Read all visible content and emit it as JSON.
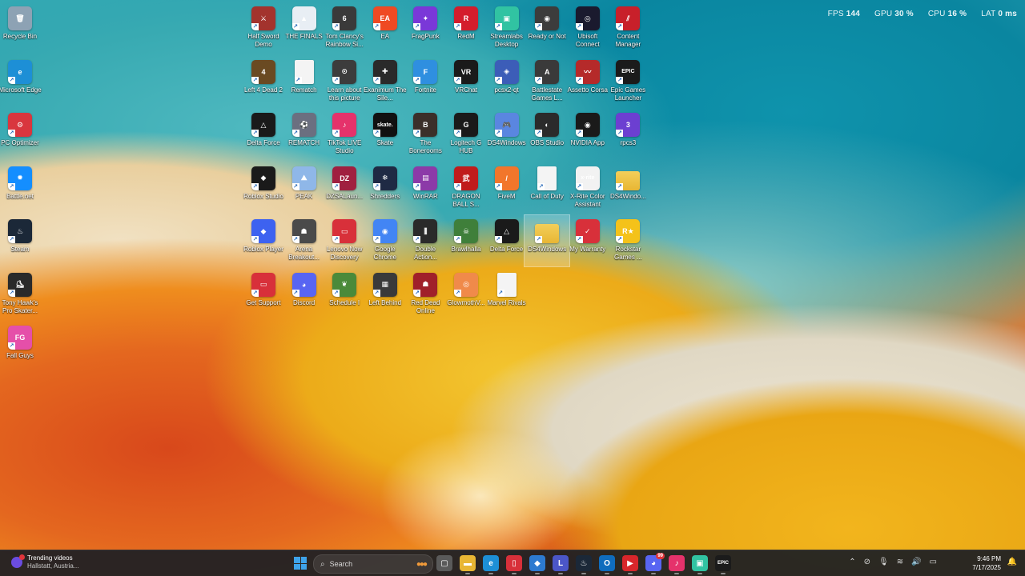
{
  "overlay": {
    "fps_label": "FPS",
    "fps_value": "144",
    "gpu_label": "GPU",
    "gpu_value": "30 %",
    "cpu_label": "CPU",
    "cpu_value": "16 %",
    "lat_label": "LAT",
    "lat_value": "0 ms"
  },
  "desktop": {
    "icons": [
      {
        "label": "Recycle Bin",
        "icon": "recycle-bin-icon",
        "color": "#8da2b4",
        "glyph": "🗑"
      },
      {
        "label": "Microsoft Edge",
        "icon": "edge-icon",
        "color": "#1d8fd6",
        "glyph": "e"
      },
      {
        "label": "PC Optimizer",
        "icon": "pc-optimizer-icon",
        "color": "#d9363e",
        "glyph": "⚙"
      },
      {
        "label": "Battle.net",
        "icon": "battlenet-icon",
        "color": "#148eff",
        "glyph": "✹"
      },
      {
        "label": "Steam",
        "icon": "steam-icon",
        "color": "#1b2838",
        "glyph": "♨"
      },
      {
        "label": "Tony Hawk's Pro Skater...",
        "icon": "tony-hawk-icon",
        "color": "#2a2a2a",
        "glyph": "⛸"
      },
      {
        "label": "Fall Guys",
        "icon": "fall-guys-icon",
        "color": "#e54fa9",
        "glyph": "FG"
      },
      {
        "label": "Half Sword Demo",
        "icon": "half-sword-icon",
        "color": "#a3332d",
        "glyph": "⚔"
      },
      {
        "label": "THE FINALS",
        "icon": "the-finals-icon",
        "color": "#e8eef4",
        "glyph": "▲"
      },
      {
        "label": "Tom Clancy's Rainbow Si...",
        "icon": "rainbow-six-icon",
        "color": "#3a3a3a",
        "glyph": "6"
      },
      {
        "label": "EA",
        "icon": "ea-icon",
        "color": "#ef4a23",
        "glyph": "EA"
      },
      {
        "label": "FragPunk",
        "icon": "fragpunk-icon",
        "color": "#7a38d8",
        "glyph": "✦"
      },
      {
        "label": "RedM",
        "icon": "redm-icon",
        "color": "#d41d2c",
        "glyph": "R"
      },
      {
        "label": "Streamlabs Desktop",
        "icon": "streamlabs-icon",
        "color": "#31c3a2",
        "glyph": "▣"
      },
      {
        "label": "Ready or Not",
        "icon": "ready-or-not-icon",
        "color": "#3c3c3c",
        "glyph": "◉"
      },
      {
        "label": "Ubisoft Connect",
        "icon": "ubisoft-icon",
        "color": "#1a1a2e",
        "glyph": "◎"
      },
      {
        "label": "Content Manager",
        "icon": "content-manager-icon",
        "color": "#c8202a",
        "glyph": "⫽"
      },
      {
        "label": "Left 4 Dead 2",
        "icon": "left4dead-icon",
        "color": "#6a4a22",
        "glyph": "4"
      },
      {
        "label": "Rematch",
        "icon": "rematch-file-icon",
        "color": "#f4f4f4",
        "glyph": "",
        "type": "doc"
      },
      {
        "label": "Learn about this picture",
        "icon": "spotlight-icon",
        "color": "#3c3c3c",
        "glyph": "⊙"
      },
      {
        "label": "Exanimum The Sile...",
        "icon": "exanimum-icon",
        "color": "#2a2a2a",
        "glyph": "✚"
      },
      {
        "label": "Fortnite",
        "icon": "fortnite-icon",
        "color": "#2f8fe0",
        "glyph": "F"
      },
      {
        "label": "VRChat",
        "icon": "vrchat-icon",
        "color": "#1a1a1a",
        "glyph": "VR"
      },
      {
        "label": "pcsx2-qt",
        "icon": "pcsx2-icon",
        "color": "#3c5db8",
        "glyph": "◈"
      },
      {
        "label": "Battlestate Games L...",
        "icon": "battlestate-icon",
        "color": "#3a3a3a",
        "glyph": "A"
      },
      {
        "label": "Assetto Corsa",
        "icon": "assetto-corsa-icon",
        "color": "#b52a2a",
        "glyph": "〰"
      },
      {
        "label": "Epic Games Launcher",
        "icon": "epic-games-icon",
        "color": "#1b1b1b",
        "glyph": "EPIC"
      },
      {
        "label": "Delta Force",
        "icon": "delta-force-icon",
        "color": "#1a1a1a",
        "glyph": "△"
      },
      {
        "label": "REMATCH",
        "icon": "rematch-icon",
        "color": "#6b6f80",
        "glyph": "⚽"
      },
      {
        "label": "TikTok LIVE Studio",
        "icon": "tiktok-live-icon",
        "color": "#e5326b",
        "glyph": "♪"
      },
      {
        "label": "Skate",
        "icon": "skate-icon",
        "color": "#111111",
        "glyph": "skate."
      },
      {
        "label": "The Bonerooms",
        "icon": "bonerooms-icon",
        "color": "#3b2f2a",
        "glyph": "B"
      },
      {
        "label": "Logitech G HUB",
        "icon": "logitech-ghub-icon",
        "color": "#1a1a1a",
        "glyph": "G"
      },
      {
        "label": "DS4Windows",
        "icon": "ds4windows-icon",
        "color": "#5a86e0",
        "glyph": "🎮"
      },
      {
        "label": "OBS Studio",
        "icon": "obs-icon",
        "color": "#2b2b2b",
        "glyph": "◐"
      },
      {
        "label": "NVIDIA App",
        "icon": "nvidia-icon",
        "color": "#1a1a1a",
        "glyph": "◉"
      },
      {
        "label": "rpcs3",
        "icon": "rpcs3-icon",
        "color": "#6c3fd1",
        "glyph": "3"
      },
      {
        "label": "Roblox Studio",
        "icon": "roblox-studio-icon",
        "color": "#1a1a1a",
        "glyph": "◆"
      },
      {
        "label": "PEAK",
        "icon": "peak-icon",
        "color": "#8fb7e8",
        "glyph": "⛰"
      },
      {
        "label": "DZSALaun...",
        "icon": "dzsa-launcher-icon",
        "color": "#a02040",
        "glyph": "DZ"
      },
      {
        "label": "Shredders",
        "icon": "shredders-icon",
        "color": "#1f2a44",
        "glyph": "❄"
      },
      {
        "label": "WinRAR",
        "icon": "winrar-icon",
        "color": "#8c3aa8",
        "glyph": "▤"
      },
      {
        "label": "DRAGON BALL S...",
        "icon": "dragon-ball-icon",
        "color": "#c01c1c",
        "glyph": "武"
      },
      {
        "label": "FiveM",
        "icon": "fivem-icon",
        "color": "#f2762b",
        "glyph": "/"
      },
      {
        "label": "Call of Duty",
        "icon": "call-of-duty-file-icon",
        "color": "#f4f4f4",
        "glyph": "",
        "type": "doc"
      },
      {
        "label": "X-Rite Color Assistant",
        "icon": "xrite-icon",
        "color": "#f2f2f2",
        "glyph": "x·rite"
      },
      {
        "label": "DS4Windo...",
        "icon": "ds4windows-folder-icon",
        "color": "#f0c64a",
        "glyph": "",
        "type": "folder"
      },
      {
        "label": "Roblox Player",
        "icon": "roblox-player-icon",
        "color": "#3d62f0",
        "glyph": "◆"
      },
      {
        "label": "Arena Breakout...",
        "icon": "arena-breakout-icon",
        "color": "#4a4a4a",
        "glyph": "☗"
      },
      {
        "label": "Lenovo Now Discovery",
        "icon": "lenovo-now-icon",
        "color": "#d8303a",
        "glyph": "▭"
      },
      {
        "label": "Google Chrome",
        "icon": "chrome-icon",
        "color": "#4285f4",
        "glyph": "◉"
      },
      {
        "label": "Double Action...",
        "icon": "double-action-icon",
        "color": "#2a2a2a",
        "glyph": "⫼"
      },
      {
        "label": "Brawlhalla",
        "icon": "brawlhalla-icon",
        "color": "#3f7f3a",
        "glyph": "☠"
      },
      {
        "label": "Delta Force",
        "icon": "delta-force-icon",
        "color": "#1a1a1a",
        "glyph": "△"
      },
      {
        "label": "DS4Windows",
        "icon": "ds4windows-folder-icon",
        "color": "#f0c64a",
        "glyph": "",
        "type": "folder",
        "selected": true
      },
      {
        "label": "My Warranty",
        "icon": "my-warranty-icon",
        "color": "#d8303a",
        "glyph": "✓"
      },
      {
        "label": "Rockstar Games ...",
        "icon": "rockstar-icon",
        "color": "#f4c21a",
        "glyph": "R★"
      },
      {
        "label": "Get Support",
        "icon": "get-support-icon",
        "color": "#d8303a",
        "glyph": "▭"
      },
      {
        "label": "Discord",
        "icon": "discord-icon",
        "color": "#5865f2",
        "glyph": "◕"
      },
      {
        "label": "Schedule I",
        "icon": "schedule-one-icon",
        "color": "#4a8a3a",
        "glyph": "❦"
      },
      {
        "label": "Left Behind",
        "icon": "left-behind-icon",
        "color": "#3a3a3a",
        "glyph": "▦"
      },
      {
        "label": "Red Dead Online",
        "icon": "red-dead-online-icon",
        "color": "#a0202a",
        "glyph": "☗"
      },
      {
        "label": "GlowmothV...",
        "icon": "glowmoth-icon",
        "color": "#f08a4a",
        "glyph": "◎"
      },
      {
        "label": "Marvel Rivals",
        "icon": "marvel-rivals-file-icon",
        "color": "#f4f4f4",
        "glyph": "",
        "type": "doc"
      }
    ]
  },
  "taskbar": {
    "widget_title": "Trending videos",
    "widget_subtitle": "Hallstatt, Austria...",
    "search_placeholder": "Search",
    "pinned": [
      {
        "icon": "task-view-icon",
        "color": "#5a5a5a",
        "glyph": "▢"
      },
      {
        "icon": "file-explorer-icon",
        "color": "#e8b634",
        "glyph": "▬"
      },
      {
        "icon": "edge-icon",
        "color": "#1d8fd6",
        "glyph": "e"
      },
      {
        "icon": "lenovo-vantage-icon",
        "color": "#d8303a",
        "glyph": "▯"
      },
      {
        "icon": "vscode-icon",
        "color": "#2d7ad0",
        "glyph": "◆"
      },
      {
        "icon": "lenovo-legion-icon",
        "color": "#4b56c8",
        "glyph": "L"
      },
      {
        "icon": "steam-icon",
        "color": "#1b2838",
        "glyph": "♨"
      },
      {
        "icon": "outlook-icon",
        "color": "#0f6cbd",
        "glyph": "O"
      },
      {
        "icon": "youtube-icon",
        "color": "#d8262b",
        "glyph": "▶"
      },
      {
        "icon": "discord-icon",
        "color": "#5865f2",
        "glyph": "◕",
        "badge": "99"
      },
      {
        "icon": "tiktok-icon",
        "color": "#e5326b",
        "glyph": "♪"
      },
      {
        "icon": "streamlabs-icon",
        "color": "#31c3a2",
        "glyph": "▣"
      },
      {
        "icon": "epic-games-icon",
        "color": "#1b1b1b",
        "glyph": "EPIC"
      }
    ],
    "time": "9:46 PM",
    "date": "7/17/2025"
  }
}
